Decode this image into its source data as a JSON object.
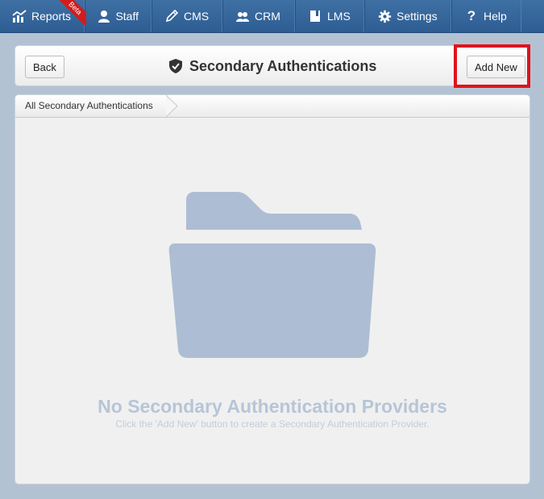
{
  "nav": {
    "items": [
      {
        "label": "Reports",
        "icon": "chart-icon",
        "badge": "Beta"
      },
      {
        "label": "Staff",
        "icon": "person-icon"
      },
      {
        "label": "CMS",
        "icon": "pencil-icon"
      },
      {
        "label": "CRM",
        "icon": "people-icon"
      },
      {
        "label": "LMS",
        "icon": "book-icon"
      },
      {
        "label": "Settings",
        "icon": "gear-icon"
      },
      {
        "label": "Help",
        "icon": "question-icon"
      }
    ]
  },
  "header": {
    "back_label": "Back",
    "title": "Secondary Authentications",
    "title_icon": "shield-check-icon",
    "add_new_label": "Add New"
  },
  "breadcrumb": {
    "label": "All Secondary Authentications"
  },
  "empty_state": {
    "icon": "folder-icon",
    "title": "No Secondary Authentication Providers",
    "subtitle": "Click the 'Add New' button to create a Secondary Authentication Provider."
  },
  "colors": {
    "nav": "#2d5d92",
    "background": "#b3c2d3",
    "highlight": "#e0121b",
    "badge": "#d11d1d",
    "folder": "#adbdd3"
  }
}
